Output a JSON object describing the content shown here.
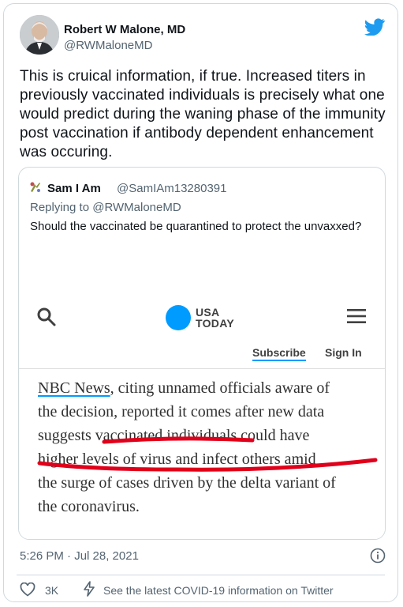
{
  "author": {
    "name": "Robert W Malone, MD",
    "handle": "@RWMaloneMD"
  },
  "tweet": {
    "text": "This is cruical information, if true.  Increased titers in previously vaccinated individuals is precisely what one would predict during the waning phase of the immunity post vaccination if antibody dependent enhancement was occuring.",
    "timestamp": "5:26 PM · Jul 28, 2021",
    "likes": "3K",
    "covid_notice": "See the latest COVID-19 information on Twitter"
  },
  "quoted": {
    "name": "Sam I Am",
    "handle": "@SamIAm13280391",
    "replying_to": "Replying to @RWMaloneMD",
    "text": "Should  the vaccinated be quarantined to protect the unvaxxed?"
  },
  "screenshot": {
    "logo_line1": "USA",
    "logo_line2": "TODAY",
    "subscribe": "Subscribe",
    "sign_in": "Sign In",
    "article_link": "NBC News",
    "article_line1_rest": ", citing unnamed officials aware of",
    "article_line2": "the decision, reported it comes after new data",
    "article_line3": "suggests vaccinated individuals could have",
    "article_line4": "higher levels of virus and infect others amid",
    "article_line5": "the surge of cases driven by the delta variant of",
    "article_line6": "the coronavirus."
  },
  "colors": {
    "twitter_blue": "#1d9bf0",
    "usa_today_blue": "#009bff",
    "annotation_red": "#e0001b",
    "secondary_text": "#536471"
  },
  "icons": [
    "twitter-bird-icon",
    "search-icon",
    "menu-icon",
    "info-icon",
    "heart-icon",
    "bolt-icon"
  ]
}
